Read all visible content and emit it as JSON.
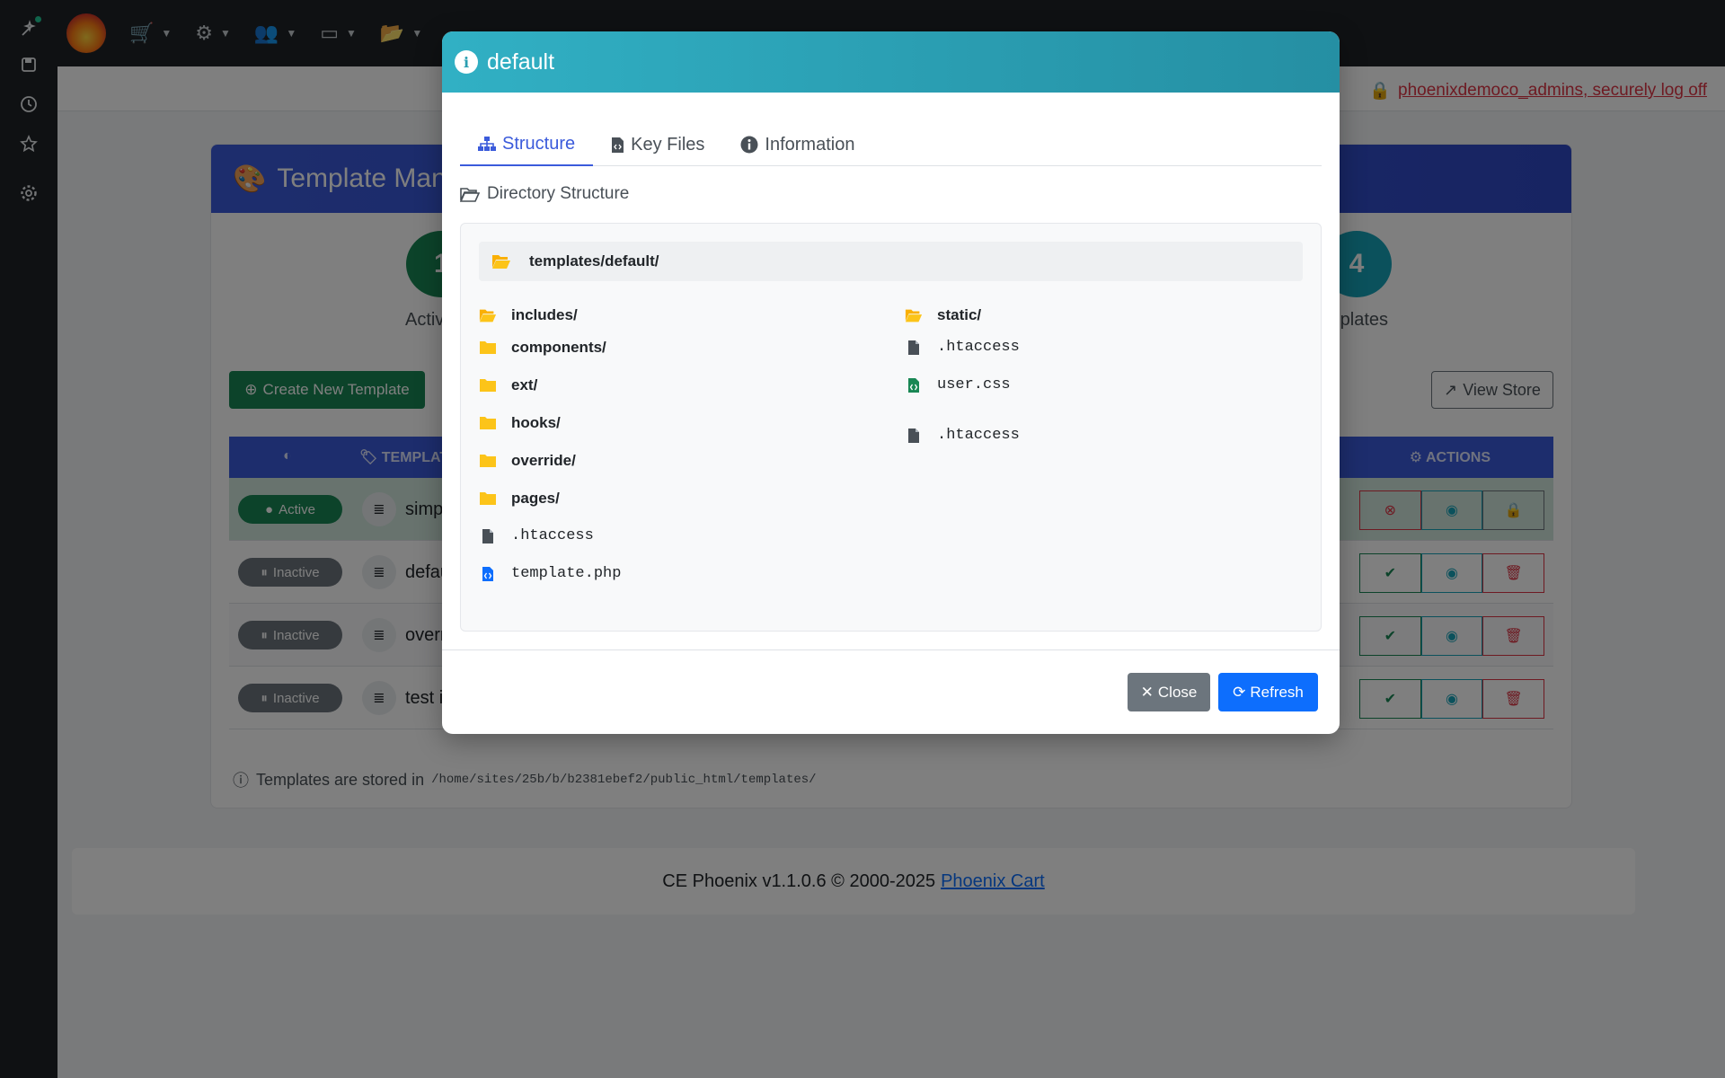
{
  "topbar": {
    "logoff_label": "phoenixdemoco_admins, securely log off"
  },
  "background": {
    "card_title": "Template Mana",
    "stats": [
      {
        "value": "1",
        "label": "Active Te",
        "color": "#198754"
      },
      {
        "value": "4",
        "label": "mplates",
        "color": "#17a2b8"
      }
    ],
    "create_button": "Create New Template",
    "view_store_button": "View Store",
    "columns": {
      "template": "TEMPLAT",
      "actions": "ACTIONS"
    },
    "rows": [
      {
        "status": "Active",
        "name": "simp"
      },
      {
        "status": "Inactive",
        "name": "defau"
      },
      {
        "status": "Inactive",
        "name": "overr"
      },
      {
        "status": "Inactive",
        "name": "test i"
      }
    ],
    "storage_label": "Templates are stored in",
    "storage_path": "/home/sites/25b/b/b2381ebef2/public_html/templates/"
  },
  "footer": {
    "text": "CE Phoenix v1.1.0.6 © 2000-2025",
    "link": "Phoenix Cart"
  },
  "modal": {
    "title": "default",
    "tabs": [
      "Structure",
      "Key Files",
      "Information"
    ],
    "active_tab": "Structure",
    "section_title": "Directory Structure",
    "root": "templates/default/",
    "left_column": [
      {
        "name": "includes/",
        "type": "folder-open"
      },
      {
        "name": "components/",
        "type": "folder"
      },
      {
        "name": "ext/",
        "type": "folder"
      },
      {
        "name": "hooks/",
        "type": "folder"
      },
      {
        "name": "override/",
        "type": "folder"
      },
      {
        "name": "pages/",
        "type": "folder"
      },
      {
        "name": ".htaccess",
        "type": "file"
      },
      {
        "name": "template.php",
        "type": "code-file"
      }
    ],
    "right_column": [
      {
        "name": "static/",
        "type": "folder-open"
      },
      {
        "name": ".htaccess",
        "type": "file"
      },
      {
        "name": "user.css",
        "type": "code-file"
      },
      {
        "name": ".htaccess",
        "type": "file"
      }
    ],
    "close_button": "Close",
    "refresh_button": "Refresh"
  },
  "colors": {
    "folder": "#fcc419",
    "file": "#495057",
    "php_file": "#0d6efd",
    "css_file": "#198754",
    "modal_header": "#2ca5b8",
    "primary": "#0d6efd"
  }
}
